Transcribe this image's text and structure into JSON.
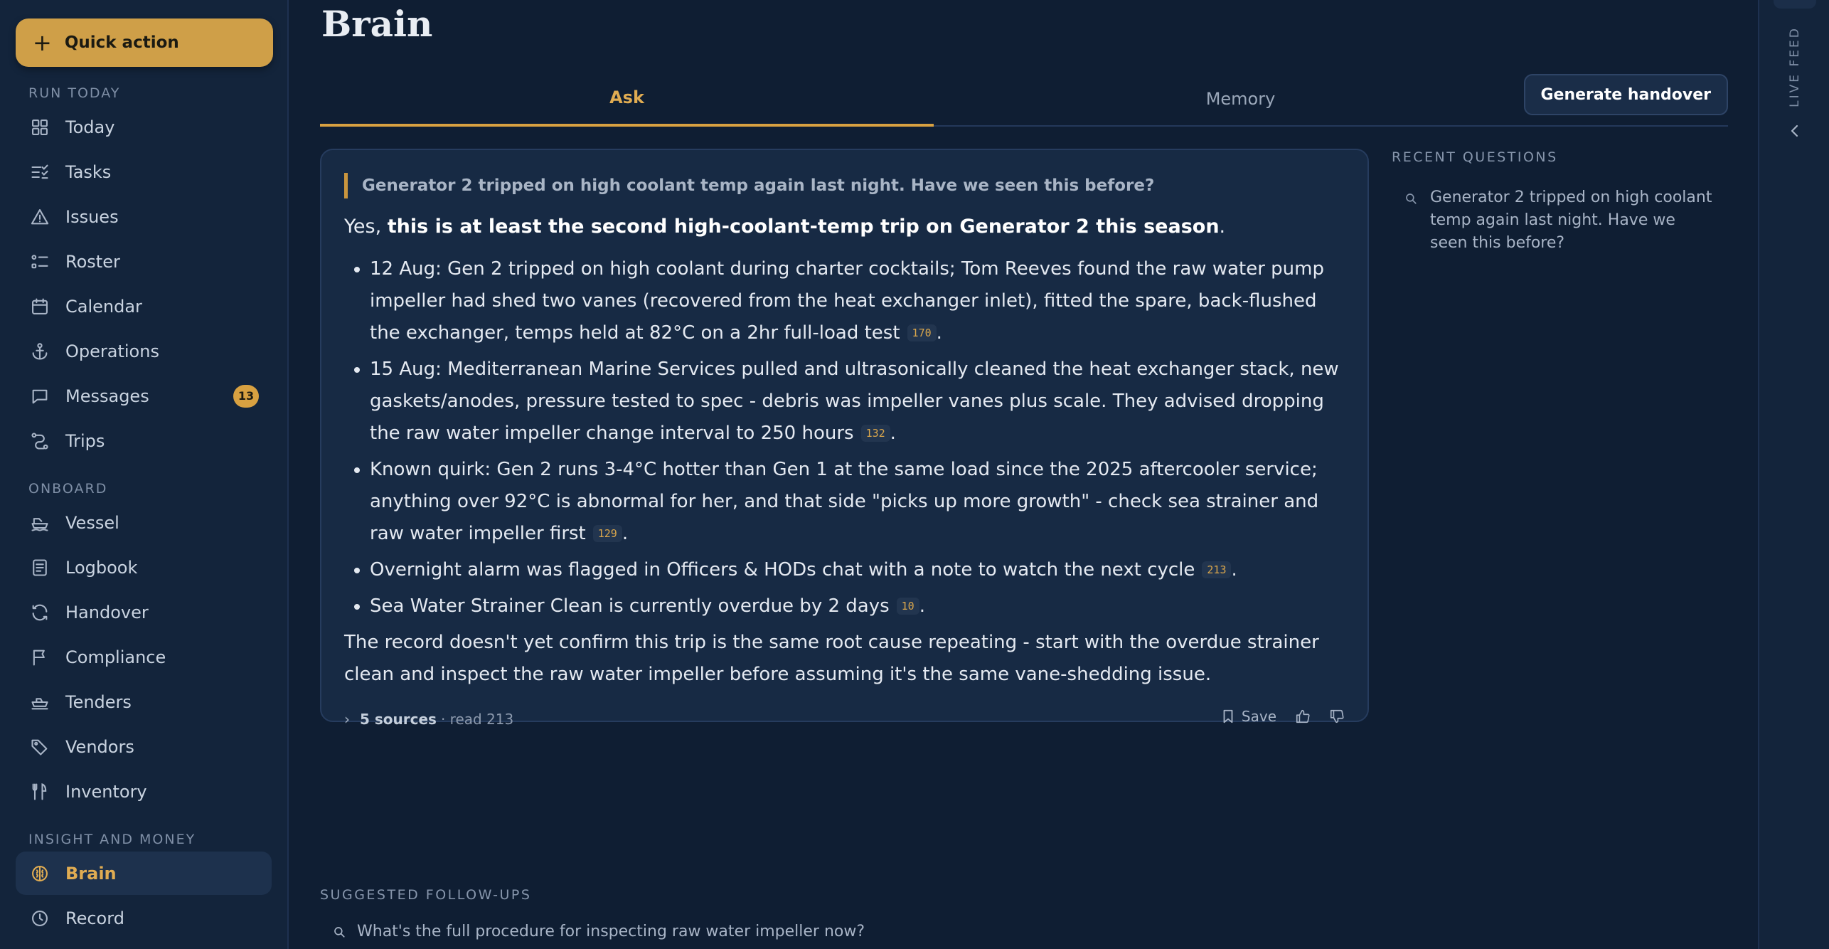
{
  "sidebar": {
    "quick_action": "Quick action",
    "sections": [
      {
        "label": "RUN TODAY",
        "items": [
          {
            "label": "Today",
            "icon": "grid-icon"
          },
          {
            "label": "Tasks",
            "icon": "checklist-icon"
          },
          {
            "label": "Issues",
            "icon": "warning-icon"
          },
          {
            "label": "Roster",
            "icon": "roster-list-icon"
          },
          {
            "label": "Calendar",
            "icon": "calendar-icon"
          },
          {
            "label": "Operations",
            "icon": "anchor-icon"
          },
          {
            "label": "Messages",
            "icon": "message-icon",
            "badge": "13"
          },
          {
            "label": "Trips",
            "icon": "route-icon"
          }
        ]
      },
      {
        "label": "ONBOARD",
        "items": [
          {
            "label": "Vessel",
            "icon": "boat-icon"
          },
          {
            "label": "Logbook",
            "icon": "logbook-icon"
          },
          {
            "label": "Handover",
            "icon": "refresh-icon"
          },
          {
            "label": "Compliance",
            "icon": "flag-icon"
          },
          {
            "label": "Tenders",
            "icon": "tender-icon"
          },
          {
            "label": "Vendors",
            "icon": "tag-icon"
          },
          {
            "label": "Inventory",
            "icon": "utensils-icon"
          }
        ]
      },
      {
        "label": "INSIGHT AND MONEY",
        "items": [
          {
            "label": "Brain",
            "icon": "brain-icon",
            "active": true
          },
          {
            "label": "Record",
            "icon": "clock-icon"
          }
        ]
      }
    ]
  },
  "main": {
    "title": "Brain",
    "tabs": [
      {
        "label": "Ask",
        "active": true
      },
      {
        "label": "Memory",
        "active": false
      }
    ],
    "generate_handover": "Generate handover",
    "answer": {
      "question": "Generator 2 tripped on high coolant temp again last night. Have we seen this before?",
      "lead_prefix": "Yes, ",
      "lead_bold": "this is at least the second high-coolant-temp trip on Generator 2 this season",
      "lead_suffix": ".",
      "bullets": [
        {
          "text": "12 Aug: Gen 2 tripped on high coolant during charter cocktails; Tom Reeves found the raw water pump impeller had shed two vanes (recovered from the heat exchanger inlet), fitted the spare, back-flushed the exchanger, temps held at 82°C on a 2hr full-load test",
          "cite": "170",
          "end": "."
        },
        {
          "text": "15 Aug: Mediterranean Marine Services pulled and ultrasonically cleaned the heat exchanger stack, new gaskets/anodes, pressure tested to spec - debris was impeller vanes plus scale. They advised dropping the raw water impeller change interval to 250 hours",
          "cite": "132",
          "end": "."
        },
        {
          "text": "Known quirk: Gen 2 runs 3-4°C hotter than Gen 1 at the same load since the 2025 aftercooler service; anything over 92°C is abnormal for her, and that side \"picks up more growth\" - check sea strainer and raw water impeller first",
          "cite": "129",
          "end": "."
        },
        {
          "text": "Overnight alarm was flagged in Officers & HODs chat with a note to watch the next cycle",
          "cite": "213",
          "end": "."
        },
        {
          "text": "Sea Water Strainer Clean is currently overdue by 2 days",
          "cite": "10",
          "end": "."
        }
      ],
      "outro": "The record doesn't yet confirm this trip is the same root cause repeating - start with the overdue strainer clean and inspect the raw water impeller before assuming it's the same vane-shedding issue.",
      "sources_label": "5 sources",
      "sources_meta": "· read 213",
      "save_label": "Save"
    },
    "followups_label": "SUGGESTED FOLLOW-UPS",
    "followups": [
      "What's the full procedure for inspecting raw water impeller now?"
    ],
    "recent_label": "RECENT QUESTIONS",
    "recent": [
      "Generator 2 tripped on high coolant temp again last night. Have we seen this before?"
    ]
  },
  "rail": {
    "label": "LIVE FEED"
  },
  "colors": {
    "accent": "#d8a141",
    "background": "#0f1e33",
    "sidebar": "#13243b",
    "card": "#172a44"
  }
}
